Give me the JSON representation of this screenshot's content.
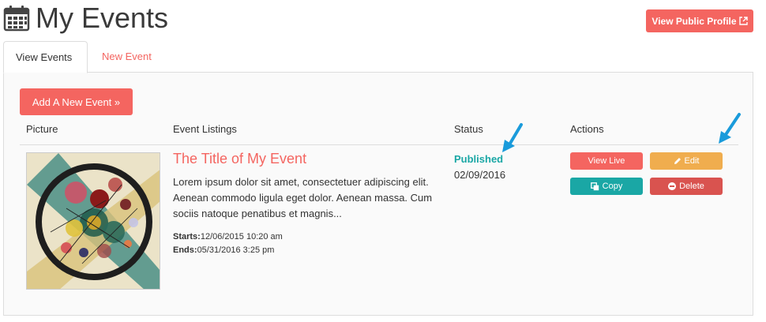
{
  "header": {
    "title": "My Events",
    "public_profile_label": "View Public Profile"
  },
  "tabs": [
    {
      "label": "View Events",
      "active": true
    },
    {
      "label": "New Event",
      "active": false
    }
  ],
  "toolbar": {
    "add_label": "Add A New Event »"
  },
  "table": {
    "columns": [
      "Picture",
      "Event Listings",
      "Status",
      "Actions"
    ],
    "rows": [
      {
        "title": "The Title of My Event",
        "description": "Lorem ipsum dolor sit amet, consectetuer adipiscing elit. Aenean commodo ligula eget dolor. Aenean massa. Cum sociis natoque penatibus et magnis...",
        "starts_label": "Starts:",
        "starts": "12/06/2015 10:20 am",
        "ends_label": "Ends:",
        "ends": "05/31/2016 3:25 pm",
        "status": "Published",
        "status_date": "02/09/2016",
        "actions": {
          "view_live": "View Live",
          "edit": "Edit",
          "copy": "Copy",
          "delete": "Delete"
        }
      }
    ]
  },
  "colors": {
    "accent": "#f46560",
    "teal": "#1aa7a5",
    "warning": "#f0ad4e",
    "danger": "#d9534f",
    "annotation_arrow": "#1a9bdb"
  },
  "icons": {
    "title": "calendar-icon",
    "public_profile": "external-link-icon",
    "edit": "pencil-icon",
    "copy": "copy-icon",
    "delete": "minus-circle-icon"
  }
}
